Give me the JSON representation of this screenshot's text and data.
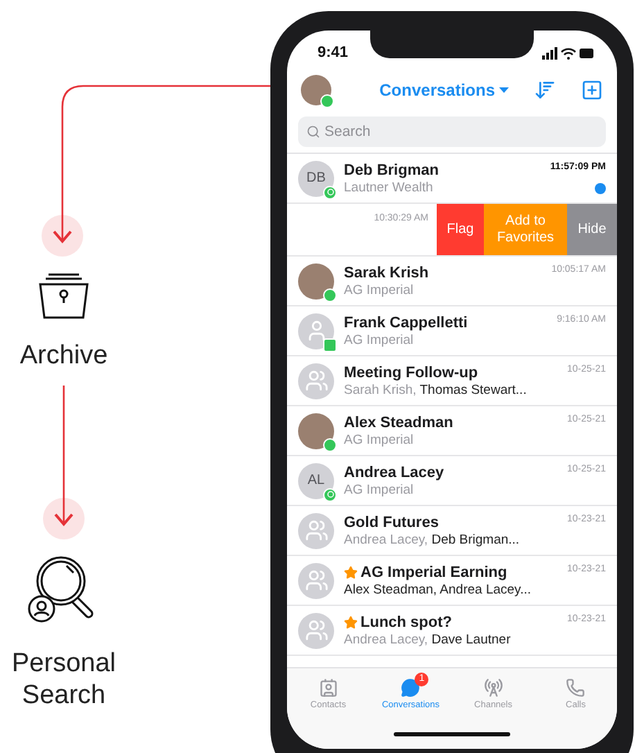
{
  "annotations": [
    {
      "kind": "archive",
      "label": "Archive"
    },
    {
      "kind": "search",
      "label": "Personal Search"
    }
  ],
  "status_bar": {
    "time": "9:41"
  },
  "header": {
    "title": "Conversations",
    "avatar": {
      "kind": "photo"
    },
    "badge": {
      "kind": "online"
    }
  },
  "search": {
    "placeholder": "Search"
  },
  "conversations": [
    {
      "kind": "conversation",
      "name": "Deb Brigman",
      "avatar": {
        "kind": "initials",
        "initials": "DB"
      },
      "badge": {
        "kind": "whatsapp"
      },
      "subtitle": [
        {
          "text": "Lautner Wealth",
          "muted": true
        }
      ],
      "time": "11:57:09 PM",
      "unread": true,
      "starred": false
    },
    {
      "kind": "swipe",
      "time": "10:30:29 AM",
      "actions": [
        {
          "label": "Flag",
          "color": "#ff3b30"
        },
        {
          "label": "Add to Favorites",
          "color": "#ff9500"
        },
        {
          "label": "Hide",
          "color": "#8e8e93"
        }
      ]
    },
    {
      "kind": "conversation",
      "name": "Sarak Krish",
      "avatar": {
        "kind": "photo"
      },
      "badge": {
        "kind": "online"
      },
      "subtitle": [
        {
          "text": "AG Imperial",
          "muted": true
        }
      ],
      "time": "10:05:17 AM",
      "unread": false,
      "starred": false
    },
    {
      "kind": "conversation",
      "name": "Frank Cappelletti",
      "avatar": {
        "kind": "person"
      },
      "badge": {
        "kind": "sms"
      },
      "subtitle": [
        {
          "text": "AG Imperial",
          "muted": true
        }
      ],
      "time": "9:16:10 AM",
      "unread": false,
      "starred": false
    },
    {
      "kind": "conversation",
      "name": "Meeting Follow-up",
      "avatar": {
        "kind": "group"
      },
      "subtitle": [
        {
          "text": "Sarah Krish,",
          "muted": true
        },
        {
          "text": "Thomas Stewart...",
          "muted": false
        }
      ],
      "time": "10-25-21",
      "unread": false,
      "starred": false
    },
    {
      "kind": "conversation",
      "name": "Alex Steadman",
      "avatar": {
        "kind": "photo"
      },
      "badge": {
        "kind": "online"
      },
      "subtitle": [
        {
          "text": "AG Imperial",
          "muted": true
        }
      ],
      "time": "10-25-21",
      "unread": false,
      "starred": false
    },
    {
      "kind": "conversation",
      "name": "Andrea Lacey",
      "avatar": {
        "kind": "initials",
        "initials": "AL"
      },
      "badge": {
        "kind": "whatsapp"
      },
      "subtitle": [
        {
          "text": "AG Imperial",
          "muted": true
        }
      ],
      "time": "10-25-21",
      "unread": false,
      "starred": false
    },
    {
      "kind": "conversation",
      "name": "Gold Futures",
      "avatar": {
        "kind": "group"
      },
      "subtitle": [
        {
          "text": "Andrea Lacey,",
          "muted": true
        },
        {
          "text": "Deb Brigman...",
          "muted": false
        }
      ],
      "time": "10-23-21",
      "unread": false,
      "starred": false
    },
    {
      "kind": "conversation",
      "name": "AG Imperial Earning",
      "avatar": {
        "kind": "group"
      },
      "subtitle": [
        {
          "text": "Alex Steadman, Andrea Lacey...",
          "muted": false
        }
      ],
      "time": "10-23-21",
      "unread": false,
      "starred": true
    },
    {
      "kind": "conversation",
      "name": "Lunch spot?",
      "avatar": {
        "kind": "group"
      },
      "subtitle": [
        {
          "text": "Andrea Lacey,",
          "muted": true
        },
        {
          "text": "Dave Lautner",
          "muted": false
        }
      ],
      "time": "10-23-21",
      "unread": false,
      "starred": true
    }
  ],
  "tabs": [
    {
      "kind": "contacts",
      "label": "Contacts",
      "selected": false
    },
    {
      "kind": "conversations",
      "label": "Conversations",
      "selected": true,
      "badge": "1"
    },
    {
      "kind": "channels",
      "label": "Channels",
      "selected": false
    },
    {
      "kind": "calls",
      "label": "Calls",
      "selected": false
    }
  ]
}
